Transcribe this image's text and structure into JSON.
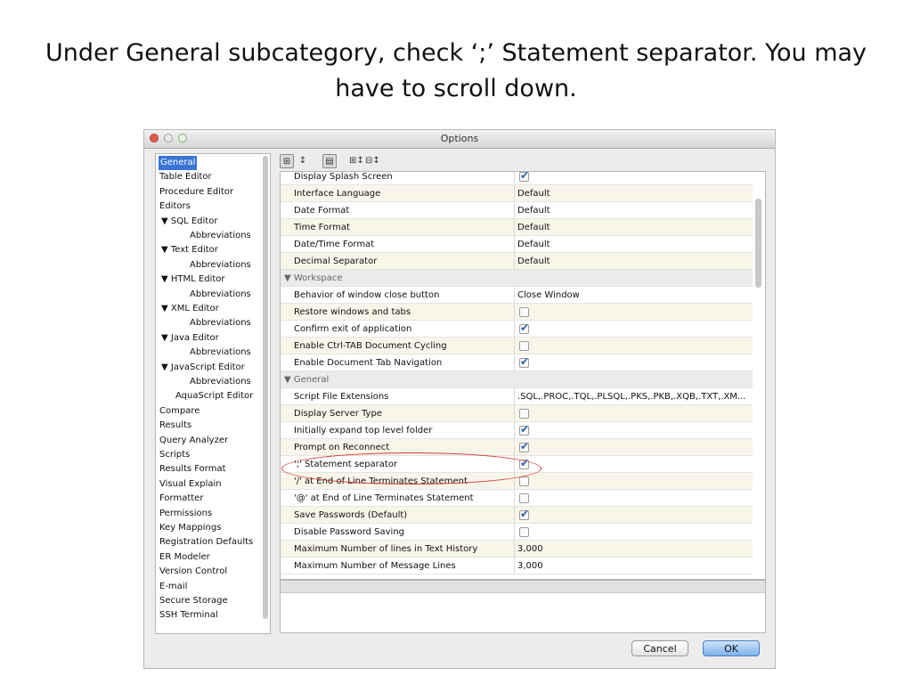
{
  "slide": {
    "title": "Under General subcategory, check ‘;’ Statement separator. You may have to scroll down."
  },
  "window": {
    "title": "Options"
  },
  "sidebar": {
    "items": [
      {
        "label": "General",
        "selected": true
      },
      {
        "label": "Table Editor"
      },
      {
        "label": "Procedure Editor"
      },
      {
        "label": "Editors"
      },
      {
        "label": "▼  SQL Editor"
      },
      {
        "label": "Abbreviations"
      },
      {
        "label": "▼  Text Editor"
      },
      {
        "label": "Abbreviations"
      },
      {
        "label": "▼  HTML Editor"
      },
      {
        "label": "Abbreviations"
      },
      {
        "label": "▼  XML Editor"
      },
      {
        "label": "Abbreviations"
      },
      {
        "label": "▼  Java Editor"
      },
      {
        "label": "Abbreviations"
      },
      {
        "label": "▼  JavaScript Editor"
      },
      {
        "label": "Abbreviations"
      },
      {
        "label": "AquaScript Editor"
      },
      {
        "label": "Compare"
      },
      {
        "label": "Results"
      },
      {
        "label": "Query Analyzer"
      },
      {
        "label": "Scripts"
      },
      {
        "label": "Results Format"
      },
      {
        "label": "Visual Explain"
      },
      {
        "label": "Formatter"
      },
      {
        "label": "Permissions"
      },
      {
        "label": "Key Mappings"
      },
      {
        "label": "Registration Defaults"
      },
      {
        "label": "ER Modeler"
      },
      {
        "label": "Version Control"
      },
      {
        "label": "E-mail"
      },
      {
        "label": "Secure Storage"
      },
      {
        "label": "SSH Terminal"
      }
    ]
  },
  "toolbar": {
    "icons": [
      "categorized-view-icon",
      "sort-alpha-icon",
      "show-description-icon",
      "expand-all-icon",
      "collapse-all-icon"
    ],
    "glyphs": [
      "⊞",
      "↕",
      "▤",
      "⊞↕",
      "⊟↕"
    ]
  },
  "settings": [
    {
      "type": "item",
      "name": "Display Splash Screen",
      "checkbox": true,
      "checked": true
    },
    {
      "type": "item",
      "name": "Interface Language",
      "value": "Default"
    },
    {
      "type": "item",
      "name": "Date Format",
      "value": "Default"
    },
    {
      "type": "item",
      "name": "Time Format",
      "value": "Default"
    },
    {
      "type": "item",
      "name": "Date/Time Format",
      "value": "Default"
    },
    {
      "type": "item",
      "name": "Decimal Separator",
      "value": "Default"
    },
    {
      "type": "category",
      "name": "▼ Workspace"
    },
    {
      "type": "item",
      "name": "Behavior of window close button",
      "value": "Close Window"
    },
    {
      "type": "item",
      "name": "Restore windows and tabs",
      "checkbox": true,
      "checked": false
    },
    {
      "type": "item",
      "name": "Confirm exit of application",
      "checkbox": true,
      "checked": true
    },
    {
      "type": "item",
      "name": "Enable Ctrl-TAB Document Cycling",
      "checkbox": true,
      "checked": false
    },
    {
      "type": "item",
      "name": "Enable Document Tab Navigation",
      "checkbox": true,
      "checked": true
    },
    {
      "type": "category",
      "name": "▼ General"
    },
    {
      "type": "item",
      "name": "Script File Extensions",
      "value": ".SQL,.PROC,.TQL,.PLSQL,.PKS,.PKB,.XQB,.TXT,.XM..."
    },
    {
      "type": "item",
      "name": "Display Server Type",
      "checkbox": true,
      "checked": false
    },
    {
      "type": "item",
      "name": "Initially expand top level folder",
      "checkbox": true,
      "checked": true
    },
    {
      "type": "item",
      "name": "Prompt on Reconnect",
      "checkbox": true,
      "checked": true
    },
    {
      "type": "item",
      "name": "';' Statement separator",
      "checkbox": true,
      "checked": true
    },
    {
      "type": "item",
      "name": "'/' at End of Line Terminates Statement",
      "checkbox": true,
      "checked": false
    },
    {
      "type": "item",
      "name": "'@' at End of Line Terminates Statement",
      "checkbox": true,
      "checked": false
    },
    {
      "type": "item",
      "name": "Save Passwords (Default)",
      "checkbox": true,
      "checked": true
    },
    {
      "type": "item",
      "name": "Disable Password Saving",
      "checkbox": true,
      "checked": false
    },
    {
      "type": "item",
      "name": "Maximum Number of lines in Text History",
      "value": "3,000"
    },
    {
      "type": "item",
      "name": "Maximum Number of Message Lines",
      "value": "3,000"
    }
  ],
  "buttons": {
    "cancel": "Cancel",
    "ok": "OK"
  },
  "colors": {
    "accent": "#3875d7",
    "highlight_circle": "#d43a3a",
    "checkbox": "#2a5fb0"
  }
}
